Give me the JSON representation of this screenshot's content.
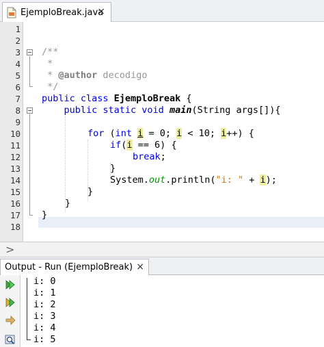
{
  "editor_tab": {
    "title": "EjemploBreak.java",
    "close": "×"
  },
  "line_numbers": [
    "1",
    "2",
    "3",
    "4",
    "5",
    "6",
    "7",
    "8",
    "9",
    "10",
    "11",
    "12",
    "13",
    "14",
    "15",
    "16",
    "17",
    "18"
  ],
  "code": {
    "l3": "/**",
    "l4": " *",
    "l5_pre": " * ",
    "l5_tag": "@author",
    "l5_val": " decodigo",
    "l6": " */",
    "l7_kw": "public class ",
    "l7_name": "EjemploBreak",
    "l7_end": " {",
    "l8_kw": "    public static void ",
    "l8_name": "main",
    "l8_end": "(String args[]){",
    "l10_kw": "for",
    "l10_a": " (",
    "l10_int": "int",
    "l10_b": " ",
    "l10_i1": "i",
    "l10_c": " = 0; ",
    "l10_i2": "i",
    "l10_d": " < 10; ",
    "l10_i3": "i",
    "l10_e": "++) {",
    "l11_kw": "if",
    "l11_a": "(",
    "l11_i": "i",
    "l11_b": " == 6) {",
    "l12": "break",
    "l12_end": ";",
    "l13": "}",
    "l14_a": "System.",
    "l14_out": "out",
    "l14_b": ".println(",
    "l14_str": "\"i: \"",
    "l14_c": " + ",
    "l14_i": "i",
    "l14_d": ");",
    "l15": "}",
    "l16": "}",
    "l17": "}"
  },
  "splitter": {
    "chevron": ">"
  },
  "output_tab": {
    "title": "Output - Run (EjemploBreak)",
    "close": "×"
  },
  "output_lines": [
    "i: 0",
    "i: 1",
    "i: 2",
    "i: 3",
    "i: 4",
    "i: 5"
  ],
  "icons": {
    "file": "java-file-icon",
    "rerun": "rerun-icon",
    "rerun_options": "rerun-with-options-icon",
    "stop": "stop-icon",
    "settings": "output-settings-icon"
  },
  "colors": {
    "keyword": "#0000e6",
    "comment": "#969696",
    "string": "#ce7b00",
    "field": "#009900",
    "highlight": "#eeeea0",
    "current_line": "#e9eff8"
  }
}
